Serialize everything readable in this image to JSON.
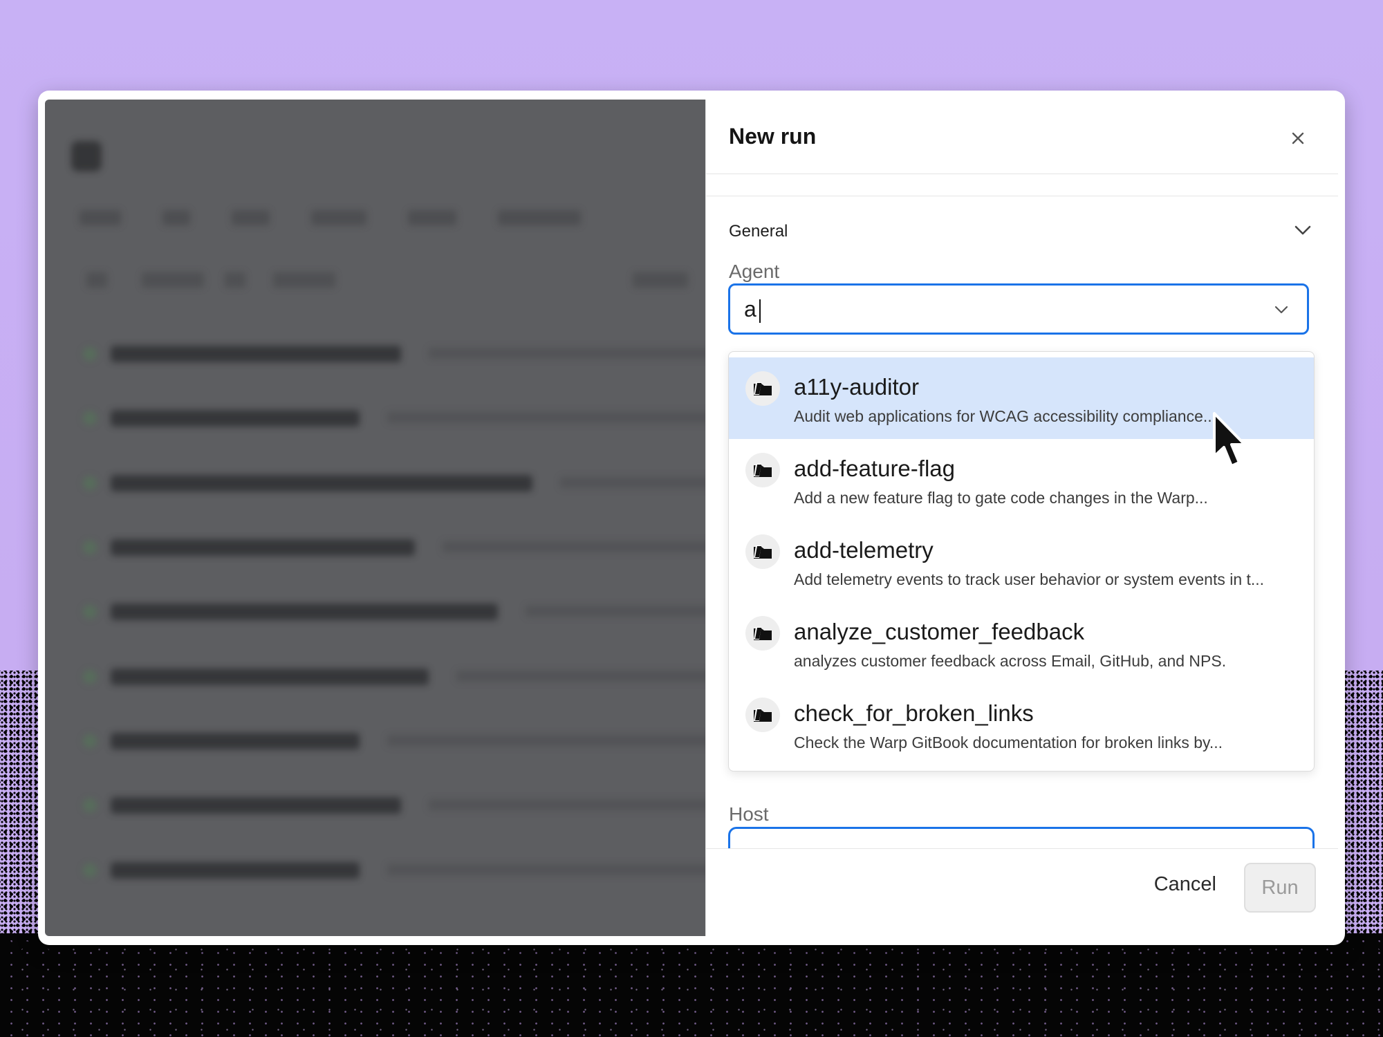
{
  "panel": {
    "title": "New run",
    "close_icon": "close-icon"
  },
  "general": {
    "label": "General",
    "chevron_icon": "chevron-down-icon"
  },
  "agent": {
    "label": "Agent",
    "value": "a",
    "chevron_icon": "chevron-down-icon",
    "options": [
      {
        "name": "a11y-auditor",
        "description": "Audit web applications for WCAG accessibility compliance....",
        "icon": "agent-icon",
        "highlighted": true
      },
      {
        "name": "add-feature-flag",
        "description": "Add a new feature flag to gate code changes in the Warp...",
        "icon": "agent-icon",
        "highlighted": false
      },
      {
        "name": "add-telemetry",
        "description": "Add telemetry events to track user behavior or system events in t...",
        "icon": "agent-icon",
        "highlighted": false
      },
      {
        "name": "analyze_customer_feedback",
        "description": "analyzes customer feedback across Email, GitHub, and NPS.",
        "icon": "agent-icon",
        "highlighted": false
      },
      {
        "name": "check_for_broken_links",
        "description": "Check the Warp GitBook documentation for broken links by...",
        "icon": "agent-icon",
        "highlighted": false
      }
    ]
  },
  "host": {
    "label": "Host"
  },
  "footer": {
    "cancel_label": "Cancel",
    "run_label": "Run"
  }
}
